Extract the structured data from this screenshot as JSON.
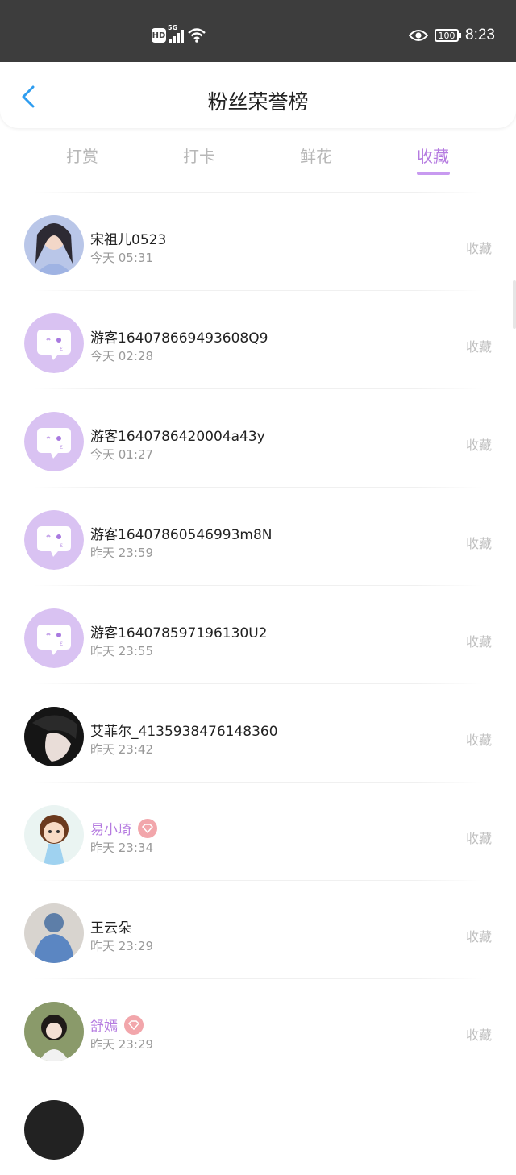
{
  "status_bar": {
    "hd_label": "HD",
    "network_label": "5G",
    "battery_label": "100",
    "time": "8:23"
  },
  "header": {
    "title": "粉丝荣誉榜"
  },
  "tabs": [
    {
      "label": "打赏",
      "active": false
    },
    {
      "label": "打卡",
      "active": false
    },
    {
      "label": "鲜花",
      "active": false
    },
    {
      "label": "收藏",
      "active": true
    }
  ],
  "colors": {
    "accent": "#b57be0",
    "status_bar": "#3d3d3d",
    "guest_avatar": "#d9c2f2",
    "vip_badge": "#f2a6ab"
  },
  "fans": [
    {
      "name": "宋祖儿0523",
      "time": "今天 05:31",
      "action": "收藏",
      "avatar": "photo-avatar-woman",
      "vip": false
    },
    {
      "name": "游客164078669493608Q9",
      "time": "今天 02:28",
      "action": "收藏",
      "avatar": "guest-chat-avatar",
      "vip": false
    },
    {
      "name": "游客1640786420004a43y",
      "time": "今天 01:27",
      "action": "收藏",
      "avatar": "guest-chat-avatar",
      "vip": false
    },
    {
      "name": "游客16407860546993m8N",
      "time": "昨天 23:59",
      "action": "收藏",
      "avatar": "guest-chat-avatar",
      "vip": false
    },
    {
      "name": "游客164078597196130U2",
      "time": "昨天 23:55",
      "action": "收藏",
      "avatar": "guest-chat-avatar",
      "vip": false
    },
    {
      "name": "艾菲尔_4135938476148360",
      "time": "昨天 23:42",
      "action": "收藏",
      "avatar": "photo-avatar-dark",
      "vip": false
    },
    {
      "name": "易小琦",
      "time": "昨天 23:34",
      "action": "收藏",
      "avatar": "cartoon-avatar",
      "vip": true
    },
    {
      "name": "王云朵",
      "time": "昨天 23:29",
      "action": "收藏",
      "avatar": "photo-avatar-blue",
      "vip": false
    },
    {
      "name": "舒嫣",
      "time": "昨天 23:29",
      "action": "收藏",
      "avatar": "photo-avatar-girl",
      "vip": true
    }
  ]
}
